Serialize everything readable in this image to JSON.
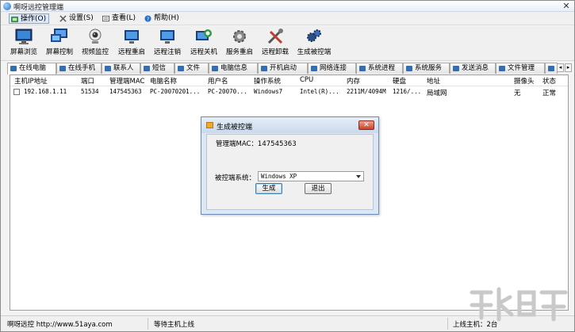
{
  "window": {
    "title": "啊呀远控管理端",
    "close_glyph": "✕"
  },
  "menu": [
    {
      "label": "操作(O)",
      "icon": "operate-icon",
      "active": true
    },
    {
      "label": "设置(S)",
      "icon": "settings-icon",
      "active": false
    },
    {
      "label": "查看(L)",
      "icon": "view-icon",
      "active": false
    },
    {
      "label": "帮助(H)",
      "icon": "help-icon",
      "active": false
    }
  ],
  "toolbar": [
    {
      "label": "屏幕浏览",
      "icon": "monitor-icon"
    },
    {
      "label": "屏幕控制",
      "icon": "screen-control-icon"
    },
    {
      "label": "视频监控",
      "icon": "webcam-icon"
    },
    {
      "label": "远程重启",
      "icon": "restart-icon"
    },
    {
      "label": "远程注销",
      "icon": "logoff-icon"
    },
    {
      "label": "远程关机",
      "icon": "shutdown-icon"
    },
    {
      "label": "服务重启",
      "icon": "gear-icon"
    },
    {
      "label": "远程卸载",
      "icon": "tools-icon"
    },
    {
      "label": "生成被控端",
      "icon": "generate-client-icon"
    }
  ],
  "tabs": [
    {
      "label": "在线电脑",
      "active": true
    },
    {
      "label": "在线手机",
      "active": false
    },
    {
      "label": "联系人",
      "active": false
    },
    {
      "label": "短信",
      "active": false
    },
    {
      "label": "文件",
      "active": false
    },
    {
      "label": "电脑信息",
      "active": false
    },
    {
      "label": "开机启动",
      "active": false
    },
    {
      "label": "网络连接",
      "active": false
    },
    {
      "label": "系统进程",
      "active": false
    },
    {
      "label": "系统服务",
      "active": false
    },
    {
      "label": "发送消息",
      "active": false
    },
    {
      "label": "文件管理",
      "active": false
    }
  ],
  "tab_scroll": {
    "left": "◂",
    "right": "▸"
  },
  "table": {
    "columns": [
      "主机IP地址",
      "端口",
      "管理端MAC",
      "电脑名称",
      "用户名",
      "操作系统",
      "CPU",
      "内存",
      "硬盘",
      "地址",
      "摄像头",
      "状态"
    ],
    "rows": [
      [
        "192.168.1.11",
        "51534",
        "147545363",
        "PC-20070201...",
        "PC-20070...",
        "Windows7",
        "Intel(R)...",
        "2211M/4094M",
        "1216/...",
        "局域网",
        "无",
        "正常"
      ]
    ]
  },
  "dialog": {
    "title": "生成被控端",
    "close_glyph": "✕",
    "mac_label": "管理端MAC：147545363",
    "os_label": "被控端系统：",
    "os_value": "Windows XP",
    "generate_button": "生成",
    "exit_button": "退出"
  },
  "status": {
    "brand": "啊呀远控 http://www.51aya.com",
    "message": "等待主机上线",
    "online_count": "上线主机：2台"
  },
  "colors": {
    "accent": "#2f6fba",
    "dialog_bg": "#dce7f3",
    "close_red": "#c7442b"
  }
}
